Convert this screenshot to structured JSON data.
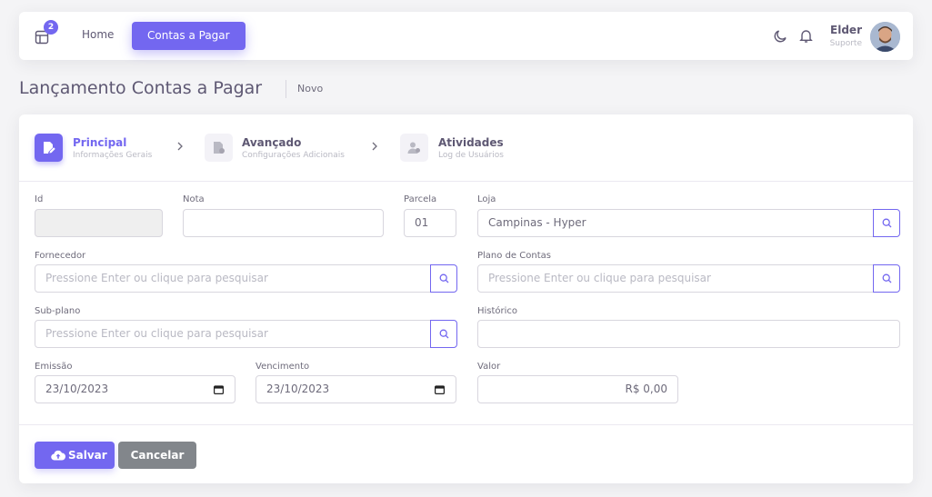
{
  "navbar": {
    "badge_count": "2",
    "home_label": "Home",
    "active_label": "Contas a Pagar",
    "user_name": "Elder",
    "user_role": "Suporte"
  },
  "page": {
    "title": "Lançamento Contas a Pagar",
    "subtitle": "Novo"
  },
  "steps": [
    {
      "title": "Principal",
      "subtitle": "Informações Gerais",
      "icon": "file-edit-icon"
    },
    {
      "title": "Avançado",
      "subtitle": "Configurações Adicionais",
      "icon": "file-icon"
    },
    {
      "title": "Atividades",
      "subtitle": "Log de Usuários",
      "icon": "user-group-icon"
    }
  ],
  "form": {
    "id": {
      "label": "Id",
      "value": ""
    },
    "nota": {
      "label": "Nota",
      "value": ""
    },
    "parcela": {
      "label": "Parcela",
      "value": "01"
    },
    "loja": {
      "label": "Loja",
      "value": "Campinas - Hyper"
    },
    "fornecedor": {
      "label": "Fornecedor",
      "placeholder": "Pressione Enter ou clique para pesquisar"
    },
    "plano": {
      "label": "Plano de Contas",
      "placeholder": "Pressione Enter ou clique para pesquisar"
    },
    "subplano": {
      "label": "Sub-plano",
      "placeholder": "Pressione Enter ou clique para pesquisar"
    },
    "historico": {
      "label": "Histórico",
      "value": ""
    },
    "emissao": {
      "label": "Emissão",
      "value": "23/10/2023"
    },
    "vencimento": {
      "label": "Vencimento",
      "value": "23/10/2023"
    },
    "valor": {
      "label": "Valor",
      "value": "R$ 0,00"
    }
  },
  "actions": {
    "save_label": "Salvar",
    "cancel_label": "Cancelar"
  },
  "colors": {
    "primary": "#7367f0",
    "secondary": "#82868b"
  }
}
